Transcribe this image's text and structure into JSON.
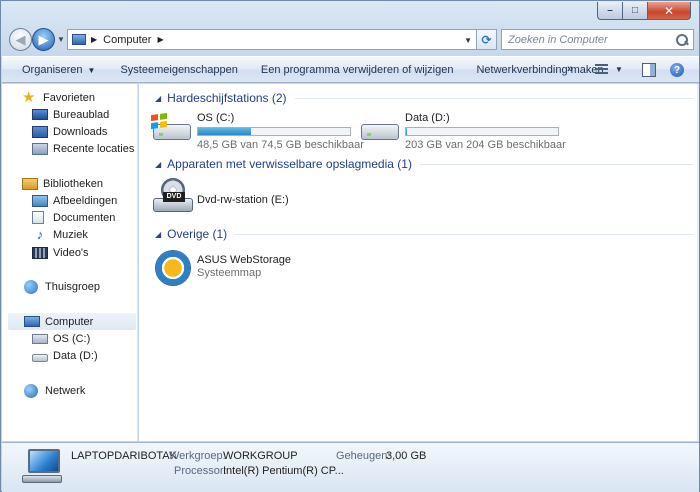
{
  "window": {
    "caption": {
      "minimize": "–",
      "maximize": "□",
      "close": "✕"
    }
  },
  "navbar": {
    "address_segment": "Computer",
    "search_placeholder": "Zoeken in Computer"
  },
  "commandbar": {
    "organize": "Organiseren",
    "items": [
      "Systeemeigenschappen",
      "Een programma verwijderen of wijzigen",
      "Netwerkverbinding maken"
    ],
    "more": "»",
    "help": "?"
  },
  "navpane": {
    "favorites": {
      "label": "Favorieten",
      "items": [
        "Bureaublad",
        "Downloads",
        "Recente locaties"
      ]
    },
    "libraries": {
      "label": "Bibliotheken",
      "items": [
        "Afbeeldingen",
        "Documenten",
        "Muziek",
        "Video's"
      ]
    },
    "homegroup": "Thuisgroep",
    "computer": {
      "label": "Computer",
      "items": [
        "OS (C:)",
        "Data (D:)"
      ]
    },
    "network": "Netwerk"
  },
  "content": {
    "groups": [
      {
        "title": "Hardeschijfstations (2)",
        "items": [
          {
            "name": "OS (C:)",
            "detail": "48,5 GB van 74,5 GB beschikbaar",
            "used_fraction": 0.35
          },
          {
            "name": "Data (D:)",
            "detail": "203 GB van 204 GB beschikbaar",
            "used_fraction": 0.005
          }
        ]
      },
      {
        "title": "Apparaten met verwisselbare opslagmedia (1)",
        "items": [
          {
            "name": "Dvd-rw-station (E:)",
            "icon_text": "DVD"
          }
        ]
      },
      {
        "title": "Overige (1)",
        "items": [
          {
            "name": "ASUS WebStorage",
            "detail": "Systeemmap"
          }
        ]
      }
    ]
  },
  "details": {
    "computer_name": "LAPTOPDARIBOTAK",
    "workgroup_label": "Werkgroep:",
    "workgroup_value": "WORKGROUP",
    "memory_label": "Geheugen:",
    "memory_value": "3,00 GB",
    "processor_label": "Processor:",
    "processor_value": "Intel(R) Pentium(R) CP..."
  },
  "colors": {
    "group_title": "#1e3e8c",
    "bar_fill": "#2a86c6"
  }
}
